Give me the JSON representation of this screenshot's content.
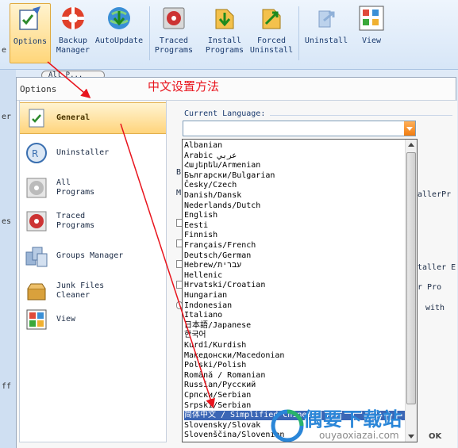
{
  "toolbar": {
    "partial_left": "e",
    "buttons": [
      {
        "label": "Options",
        "active": true
      },
      {
        "label": "Backup\nManager"
      },
      {
        "label": "AutoUpdate"
      },
      {
        "label": "Traced\nPrograms"
      },
      {
        "label": "Install\nPrograms"
      },
      {
        "label": "Forced\nUninstall"
      },
      {
        "label": "Uninstall"
      },
      {
        "label": "View"
      }
    ]
  },
  "background": {
    "tab_text": "All P...",
    "left_fragments": [
      "er",
      "es",
      "ff"
    ]
  },
  "annotation": "中文设置方法",
  "dialog": {
    "title": "Options",
    "nav": [
      {
        "label": "General",
        "selected": true,
        "icon": "checklist-icon"
      },
      {
        "label": "Uninstaller",
        "icon": "uninstaller-icon"
      },
      {
        "label": "All\nPrograms",
        "icon": "disc-icon"
      },
      {
        "label": "Traced\nPrograms",
        "icon": "traced-disc-icon"
      },
      {
        "label": "Groups Manager",
        "icon": "groups-icon"
      },
      {
        "label": "Junk Files\nCleaner",
        "icon": "junk-box-icon"
      },
      {
        "label": "View",
        "icon": "view-grid-icon"
      }
    ],
    "current_language_label": "Current Language:",
    "languages": [
      "Albanian",
      "Arabic عربي",
      "Հայերեն/Armenian",
      "Български/Bulgarian",
      "Česky/Czech",
      "Danish/Dansk",
      "Nederlands/Dutch",
      "English",
      "Eesti",
      "Finnish",
      "Français/French",
      "Deutsch/German",
      "Hebrew/עברית",
      "Hellenic",
      "Hrvatski/Croatian",
      "Hungarian",
      "Indonesian",
      "Italiano",
      "日本語/Japanese",
      "한국어",
      "Kurdî/Kurdish",
      "Македонски/Macedonian",
      "Polski/Polish",
      "Română / Romanian",
      "Russian/Русский",
      "Српски/Serbian",
      "Srpski/Serbian",
      "简体中文 / Simplified Chinese",
      "Slovensky/Slovak",
      "Slovenščina/Slovenian"
    ],
    "selected_language_index": 27,
    "right_fragments": [
      "allerPr",
      "taller E",
      "r Pro",
      "with"
    ],
    "left_fragments": [
      "B",
      "M"
    ],
    "ok_label": "OK"
  },
  "watermark": {
    "text": "偶要下载站",
    "url": "ouyaoxiazai.com"
  }
}
